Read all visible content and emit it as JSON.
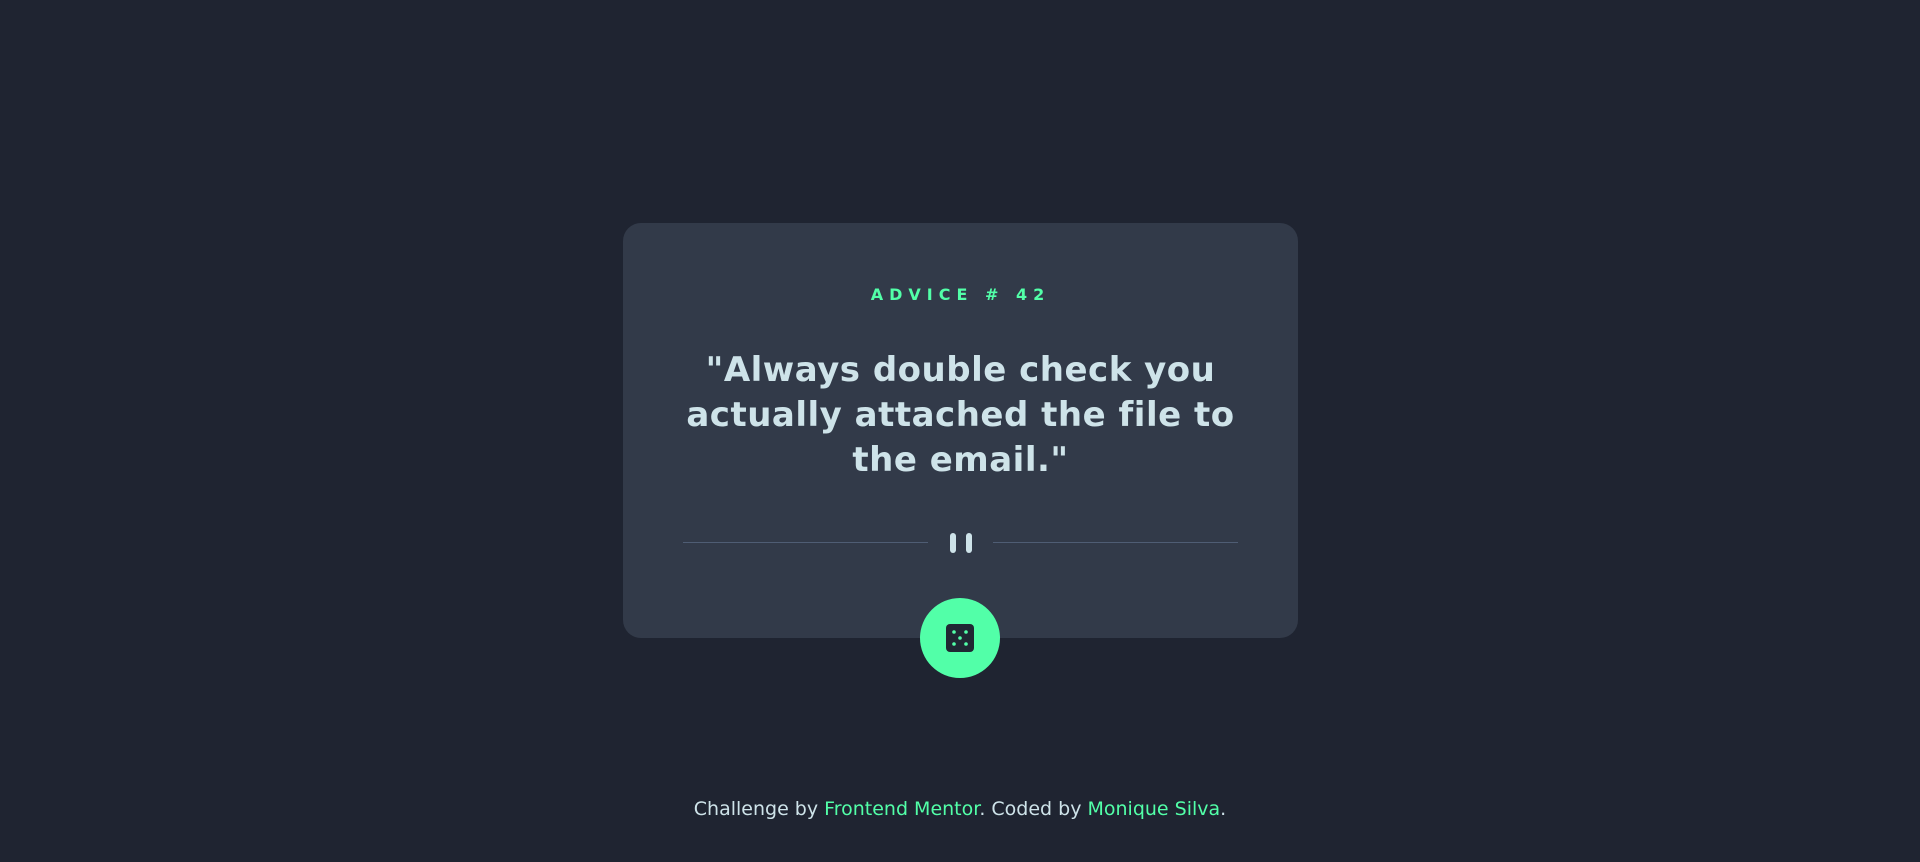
{
  "card": {
    "advice_label": "ADVICE # 42",
    "quote": "\"Always double check you actually attached the file to the email.\""
  },
  "icons": {
    "divider": "pause-icon",
    "button": "dice-icon"
  },
  "footer": {
    "prefix": "Challenge by ",
    "challenge_link": "Frontend Mentor",
    "middle": ". Coded by ",
    "author_link": "Monique Silva",
    "suffix": "."
  },
  "colors": {
    "background": "#1f2431",
    "card": "#323a49",
    "accent": "#52ffa8",
    "text": "#cee3e9",
    "divider": "#4f5d74"
  }
}
